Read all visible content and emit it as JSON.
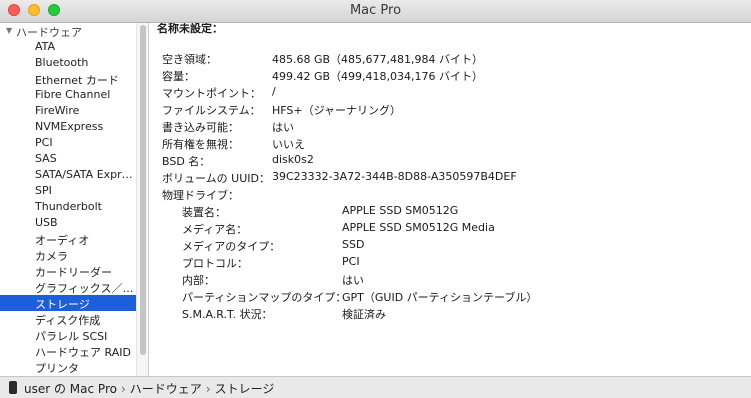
{
  "window": {
    "title": "Mac Pro"
  },
  "sidebar": {
    "group_label": "ハードウェア",
    "items": [
      "ATA",
      "Bluetooth",
      "Ethernet カード",
      "Fibre Channel",
      "FireWire",
      "NVMExpress",
      "PCI",
      "SAS",
      "SATA/SATA Expr…",
      "SPI",
      "Thunderbolt",
      "USB",
      "オーディオ",
      "カメラ",
      "カードリーダー",
      "グラフィックス／…",
      "ストレージ",
      "ディスク作成",
      "パラレル SCSI",
      "ハードウェア RAID",
      "プリンタ"
    ],
    "selected_item": "ストレージ"
  },
  "detail": {
    "header": "名称未設定：",
    "fields": [
      {
        "key": "空き領域：",
        "value": "485.68 GB（485,677,481,984 バイト）"
      },
      {
        "key": "容量：",
        "value": "499.42 GB（499,418,034,176 バイト）"
      },
      {
        "key": "マウントポイント：",
        "value": "/"
      },
      {
        "key": "ファイルシステム：",
        "value": "HFS+（ジャーナリング）"
      },
      {
        "key": "書き込み可能：",
        "value": "はい"
      },
      {
        "key": "所有権を無視：",
        "value": "いいえ"
      },
      {
        "key": "BSD 名：",
        "value": "disk0s2"
      },
      {
        "key": "ボリュームの UUID：",
        "value": "39C23332-3A72-344B-8D88-A350597B4DEF"
      },
      {
        "key": "物理ドライブ：",
        "value": ""
      }
    ],
    "drive_fields": [
      {
        "key": "装置名：",
        "value": "APPLE SSD SM0512G"
      },
      {
        "key": "メディア名：",
        "value": "APPLE SSD SM0512G Media"
      },
      {
        "key": "メディアのタイプ：",
        "value": "SSD"
      },
      {
        "key": "プロトコル：",
        "value": "PCI"
      },
      {
        "key": "内部：",
        "value": "はい"
      },
      {
        "key": "パーティションマップのタイプ：",
        "value": "GPT（GUID パーティションテーブル）"
      },
      {
        "key": "S.M.A.R.T. 状況：",
        "value": "検証済み"
      }
    ]
  },
  "statusbar": {
    "icon": "mac-pro-icon",
    "crumbs": [
      "user の Mac Pro",
      "ハードウェア",
      "ストレージ"
    ],
    "separator": "›"
  },
  "colors": {
    "selection": "#1d5fd8"
  }
}
